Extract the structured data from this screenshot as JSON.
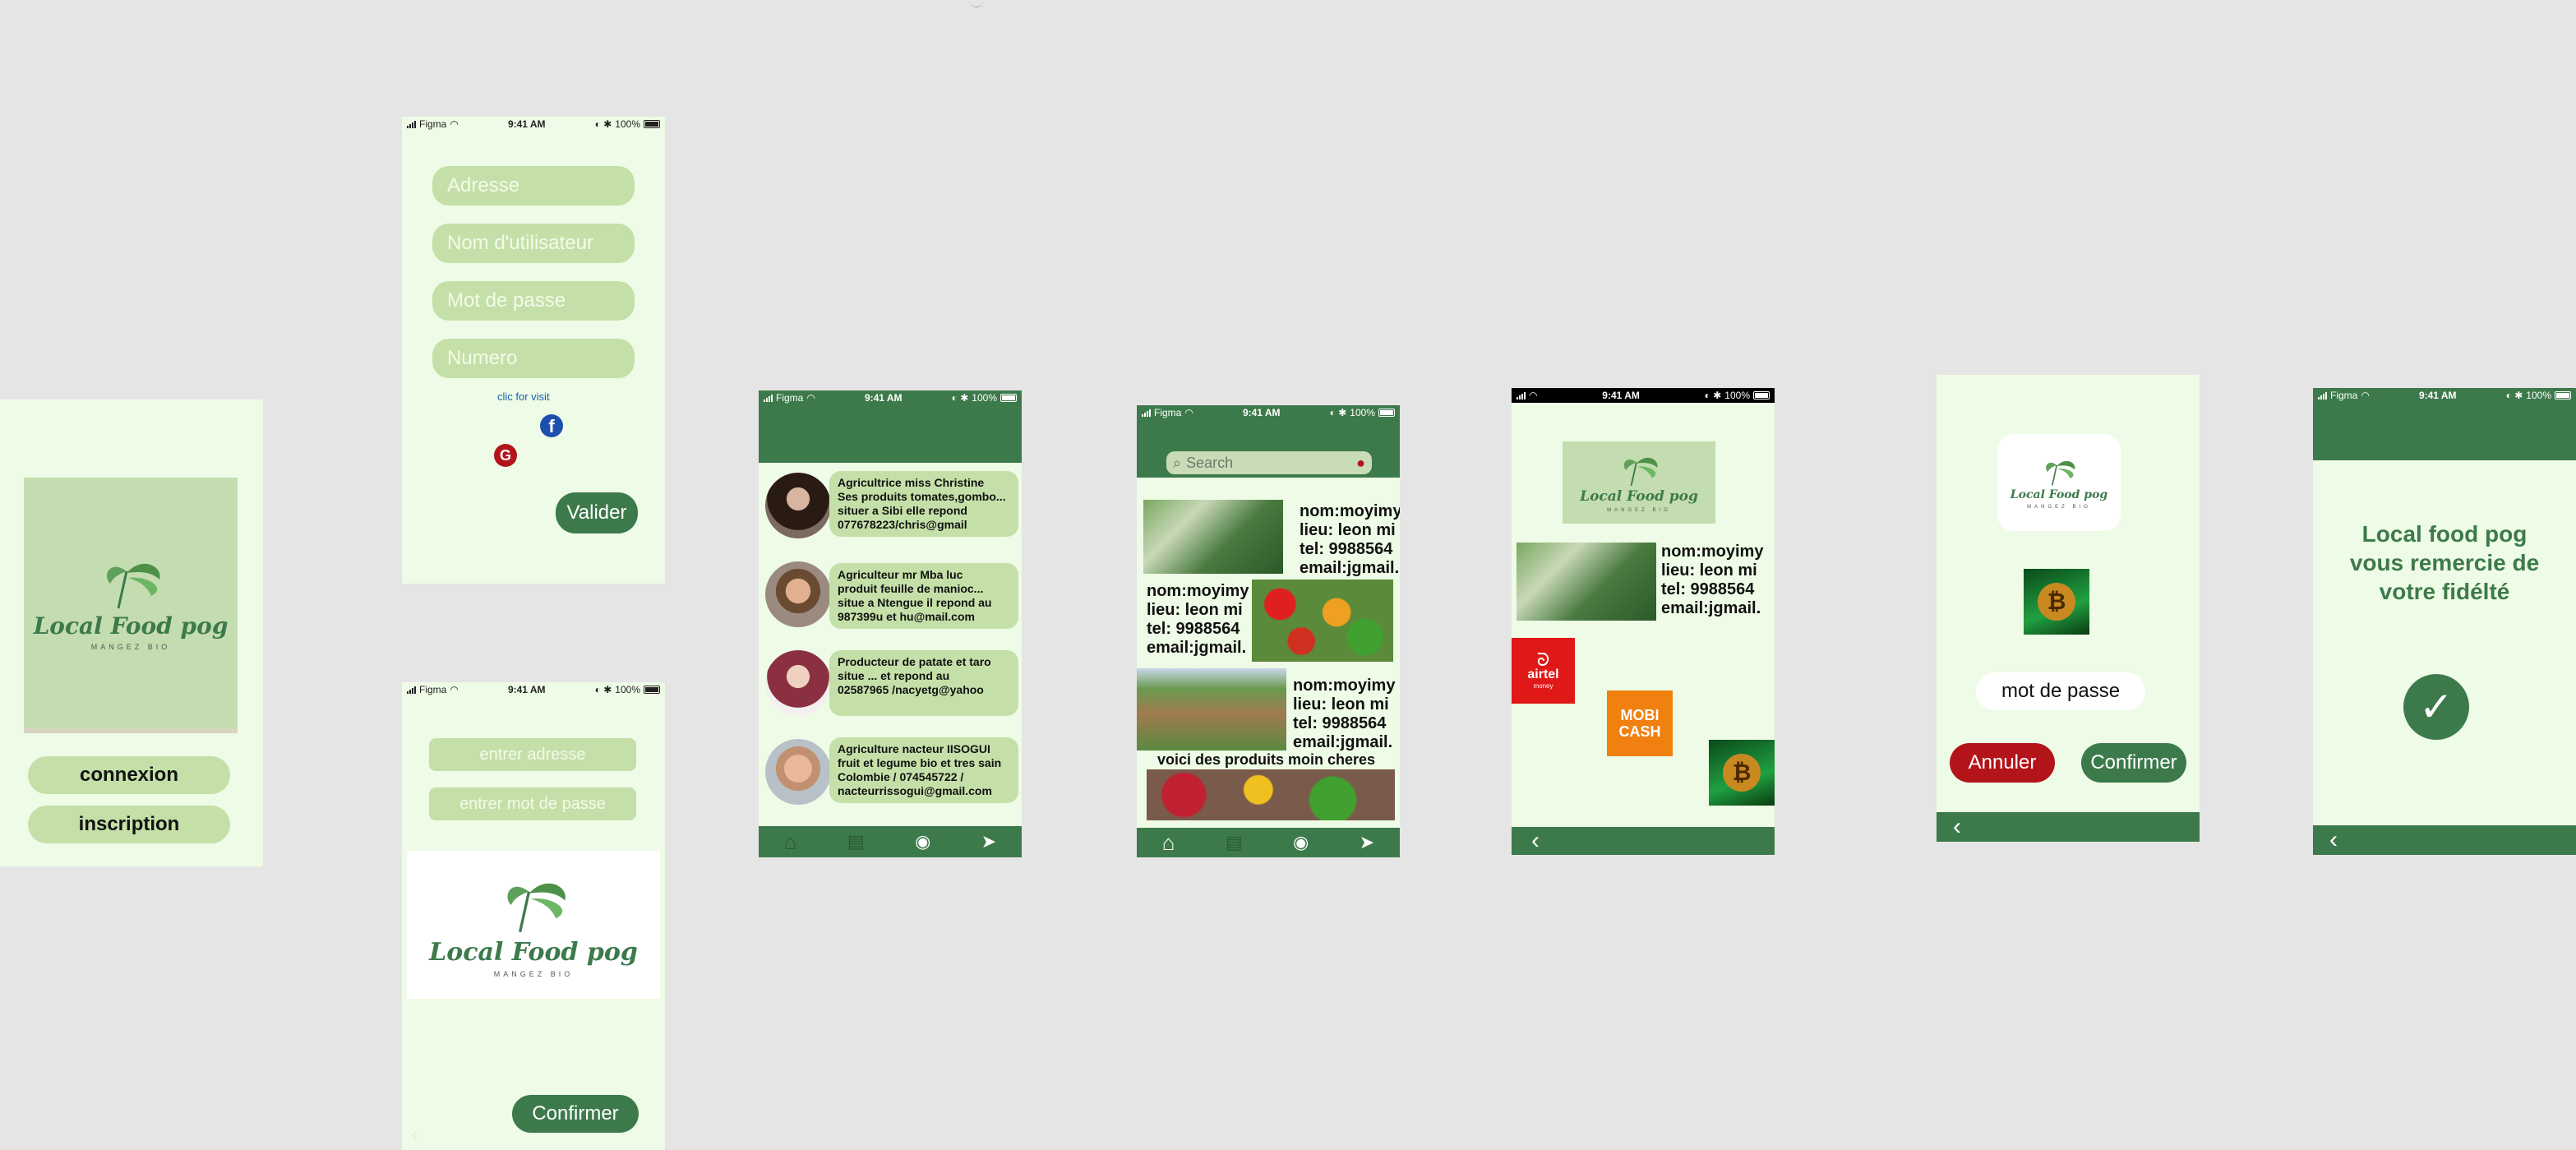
{
  "status": {
    "carrier": "Figma",
    "time": "9:41 AM",
    "battery": "100%"
  },
  "logo": {
    "title": "Local Food pog",
    "subtitle": "MANGEZ BIO"
  },
  "splash": {
    "connexion_label": "connexion",
    "inscription_label": "inscription"
  },
  "signup": {
    "address_placeholder": "Adresse",
    "username_placeholder": "Nom d'utilisateur",
    "password_placeholder": "Mot de passe",
    "number_placeholder": "Numero",
    "visit_link": "clic for visit",
    "validate_label": "Valider"
  },
  "login": {
    "address_placeholder": "entrer adresse",
    "password_placeholder": "entrer mot de passe",
    "confirm_label": "Confirmer"
  },
  "producers": [
    {
      "text": "Agricultrice  miss Christine\nSes produits tomates,gombo...\nsituer a Sibi elle repond\n077678223/chris@gmail"
    },
    {
      "text": "Agriculteur mr Mba luc\nproduit feuille de manioc...\nsitue a Ntengue il repond au\n987399u et hu@mail.com"
    },
    {
      "text": "Producteur de patate et taro\nsitue ... et repond au\n02587965 /nacyetg@yahoo"
    },
    {
      "text": "Agriculture nacteur IISOGUI\nfruit et legume bio et tres sain\nColombie / 074545722 /\nnacteurrissogui@gmail.com"
    }
  ],
  "products": {
    "search_placeholder": "Search",
    "info": "nom:moyimy\nlieu: leon mi\ntel: 9988564\nemail:jgmail.",
    "cheap_label": "voici des produits moin cheres"
  },
  "payment": {
    "info": "nom:moyimy\nlieu: leon mi\ntel: 9988564\nemail:jgmail.",
    "airtel_label": "airtel",
    "airtel_sub": "money",
    "mobicash_label": "MOBI CASH"
  },
  "confirm_pay": {
    "password_label": "mot de passe",
    "cancel_label": "Annuler",
    "confirm_label": "Confirmer"
  },
  "thanks": {
    "message": "Local food pog vous remercie de votre fidélté"
  },
  "colors": {
    "accent": "#3d7a4b",
    "light_green": "#c4e0a8",
    "bg": "#eefbe6",
    "cancel": "#b3141a"
  }
}
